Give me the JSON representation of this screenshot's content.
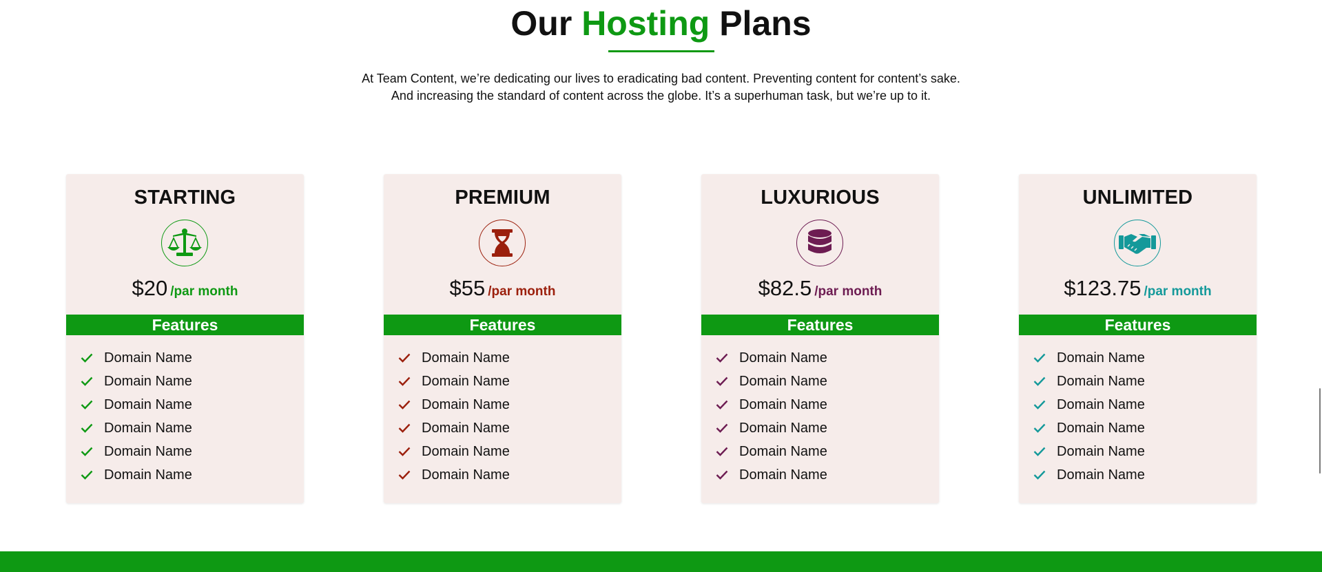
{
  "heading": {
    "part1": "Our",
    "part2": "Hosting",
    "part3": "Plans"
  },
  "intro": {
    "line1": "At Team Content, we’re dedicating our lives to eradicating bad content. Preventing content for content’s sake.",
    "line2": "And increasing the standard of content across the globe. It’s a superhuman task, but we’re up to it."
  },
  "colors": {
    "brand_green": "#0e9913",
    "card_bg": "#f6ecea"
  },
  "plans": [
    {
      "name": "STARTING",
      "icon": "balance-scale-icon",
      "color": "#0e9913",
      "price": "$20",
      "period": "/par month",
      "features_label": "Features",
      "features": [
        "Domain Name",
        "Domain Name",
        "Domain Name",
        "Domain Name",
        "Domain Name",
        "Domain Name"
      ]
    },
    {
      "name": "PREMIUM",
      "icon": "hourglass-icon",
      "color": "#9b1f0c",
      "price": "$55",
      "period": "/par month",
      "features_label": "Features",
      "features": [
        "Domain Name",
        "Domain Name",
        "Domain Name",
        "Domain Name",
        "Domain Name",
        "Domain Name"
      ]
    },
    {
      "name": "LUXURIOUS",
      "icon": "database-icon",
      "color": "#6d1c52",
      "price": "$82.5",
      "period": "/par month",
      "features_label": "Features",
      "features": [
        "Domain Name",
        "Domain Name",
        "Domain Name",
        "Domain Name",
        "Domain Name",
        "Domain Name"
      ]
    },
    {
      "name": "UNLIMITED",
      "icon": "handshake-icon",
      "color": "#14999a",
      "price": "$123.75",
      "period": "/par month",
      "features_label": "Features",
      "features": [
        "Domain Name",
        "Domain Name",
        "Domain Name",
        "Domain Name",
        "Domain Name",
        "Domain Name"
      ]
    }
  ]
}
